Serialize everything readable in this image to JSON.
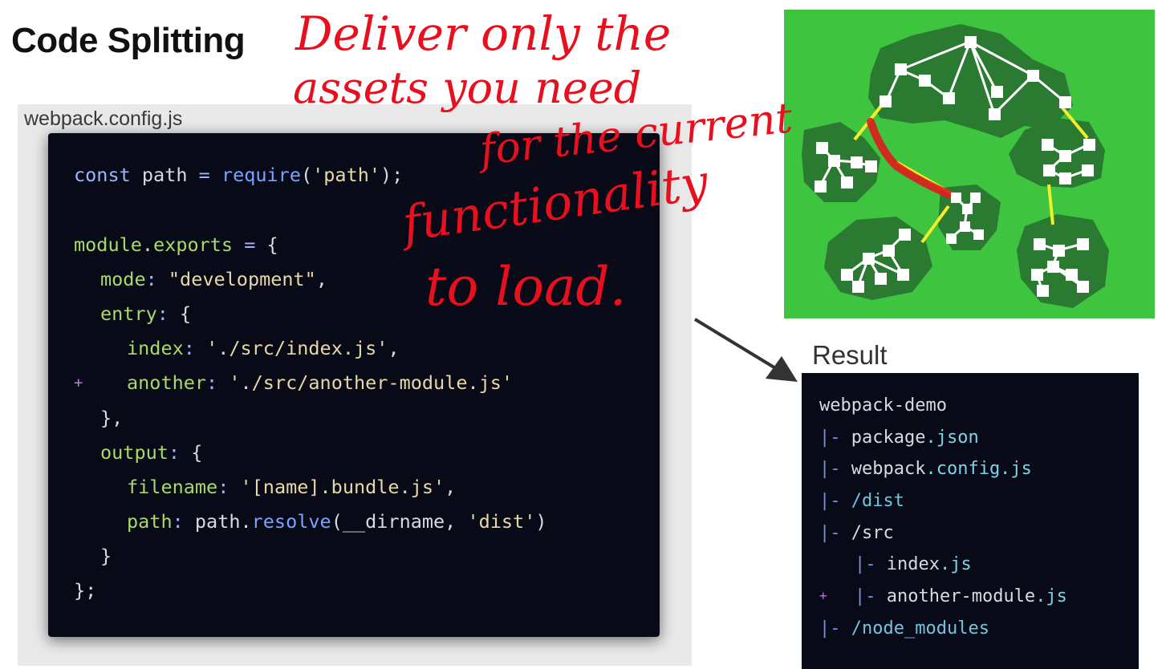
{
  "slide": {
    "title": "Code Splitting"
  },
  "config": {
    "filename": "webpack.config.js",
    "lines": {
      "l1": {
        "kw": "const",
        "mid": " path ",
        "op": "=",
        "fn": " require",
        "p1": "(",
        "str": "'path'",
        "p2": ");"
      },
      "l2": {
        "obj": "module",
        "dot": ".",
        "prop": "exports",
        "mid": " ",
        "op": "=",
        "rest": " {"
      },
      "l3": {
        "prop": "mode",
        "colon": ":",
        "mid": " ",
        "str": "\"development\"",
        "rest": ","
      },
      "l4": {
        "prop": "entry",
        "colon": ":",
        "rest": " {"
      },
      "l5": {
        "prop": "index",
        "colon": ":",
        "mid": " ",
        "str": "'./src/index.js'",
        "rest": ","
      },
      "l6": {
        "plus": "+",
        "prop": "another",
        "colon": ":",
        "mid": " ",
        "str": "'./src/another-module.js'"
      },
      "l7": {
        "text": "},"
      },
      "l8": {
        "prop": "output",
        "colon": ":",
        "rest": " {"
      },
      "l9": {
        "prop": "filename",
        "colon": ":",
        "mid": " ",
        "str": "'[name].bundle.js'",
        "rest": ","
      },
      "l10": {
        "prop": "path",
        "colon": ":",
        "mid": " path.",
        "fn": "resolve",
        "p1": "(__dirname, ",
        "str": "'dist'",
        "p2": ")"
      },
      "l11": {
        "text": "}"
      },
      "l12": {
        "text": "};"
      }
    }
  },
  "result": {
    "title": "Result",
    "root": "webpack-demo",
    "pipe": "|-",
    "plus": "+",
    "items": {
      "package": {
        "base": "package",
        "ext": ".json"
      },
      "config": {
        "base": "webpack",
        "ext": ".config.js"
      },
      "dist": {
        "dir": "/dist"
      },
      "src": {
        "dir": "/src"
      },
      "index": {
        "base": "index",
        "ext": ".js"
      },
      "another": {
        "base": "another-module",
        "ext": ".js"
      },
      "node_modules": {
        "dir": "/node_modules"
      }
    }
  },
  "annotation": {
    "color": "#e8101e",
    "lines": [
      "Deliver only the",
      "assets you need",
      "for the current",
      "functionality",
      "to load."
    ]
  },
  "colors": {
    "graph_bg": "#3ec43e",
    "graph_island": "#2b7a32",
    "graph_edge": "#f2ee2a",
    "highlight_edge": "#e01b1b"
  }
}
